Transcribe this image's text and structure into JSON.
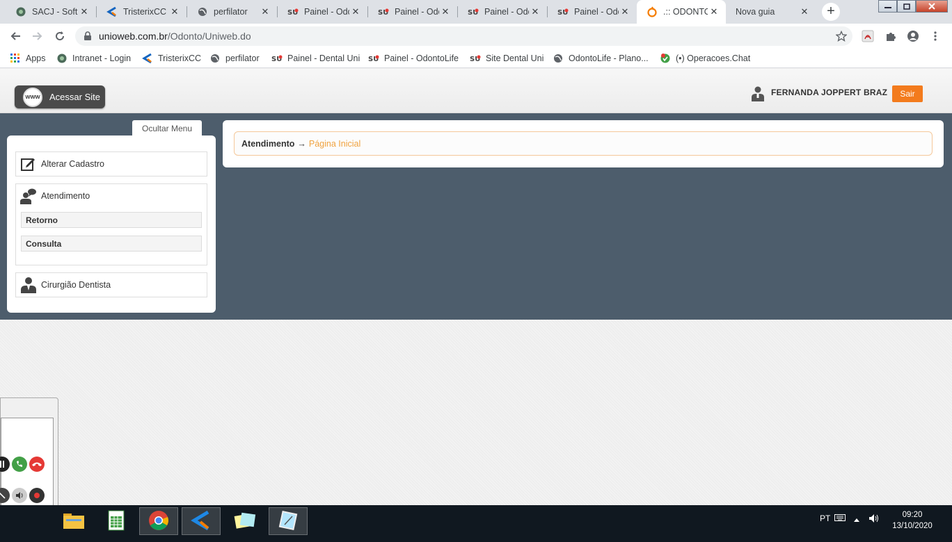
{
  "browser": {
    "tabs": [
      {
        "title": "SACJ - Softn",
        "icon": "globe-dark-icon"
      },
      {
        "title": "TristerixCC",
        "icon": "tristerix-icon"
      },
      {
        "title": "perfilator",
        "icon": "globe-icon"
      },
      {
        "title": "Painel - Odc",
        "icon": "su-logo-icon"
      },
      {
        "title": "Painel - Odc",
        "icon": "su-logo-icon"
      },
      {
        "title": "Painel - Odc",
        "icon": "su-logo-icon"
      },
      {
        "title": "Painel - Odc",
        "icon": "su-logo-icon"
      },
      {
        "title": ".:: ODONTO",
        "icon": "odonto-icon"
      },
      {
        "title": "Nova guia",
        "icon": ""
      }
    ],
    "close_glyph": "✕",
    "new_tab_glyph": "+",
    "url_host": "unioweb.com.br",
    "url_path": "/Odonto/Uniweb.do",
    "bookmarks": [
      {
        "label": "Apps",
        "icon": "apps-grid-icon"
      },
      {
        "label": "Intranet - Login",
        "icon": "globe-dark-icon"
      },
      {
        "label": "TristerixCC",
        "icon": "tristerix-icon"
      },
      {
        "label": "perfilator",
        "icon": "globe-icon"
      },
      {
        "label": "Painel - Dental Uni",
        "icon": "su-logo-icon"
      },
      {
        "label": "Painel - OdontoLife",
        "icon": "su-logo-icon"
      },
      {
        "label": "Site Dental Uni",
        "icon": "su-logo-icon"
      },
      {
        "label": "OdontoLife - Plano...",
        "icon": "globe-icon"
      },
      {
        "label": "(•) Operacoes.Chat",
        "icon": "chat-icon"
      }
    ]
  },
  "site": {
    "acessar_site": "Acessar Site",
    "www_badge": "WWW",
    "user_name": "FERNANDA JOPPERT BRAZ",
    "sair": "Sair",
    "ocultar_menu": "Ocultar Menu",
    "menu": {
      "alterar_cadastro": "Alterar Cadastro",
      "atendimento": "Atendimento",
      "retorno": "Retorno",
      "consulta": "Consulta",
      "cirurgiao": "Cirurgião Dentista"
    },
    "breadcrumb": {
      "root": "Atendimento",
      "arrow": "→",
      "current": "Página Inicial"
    }
  },
  "taskbar": {
    "language": "PT",
    "time": "09:20",
    "date": "13/10/2020"
  },
  "colors": {
    "accent_orange": "#f37b1d",
    "band": "#4d5d6c",
    "breadcrumb_link": "#f0a23e"
  }
}
